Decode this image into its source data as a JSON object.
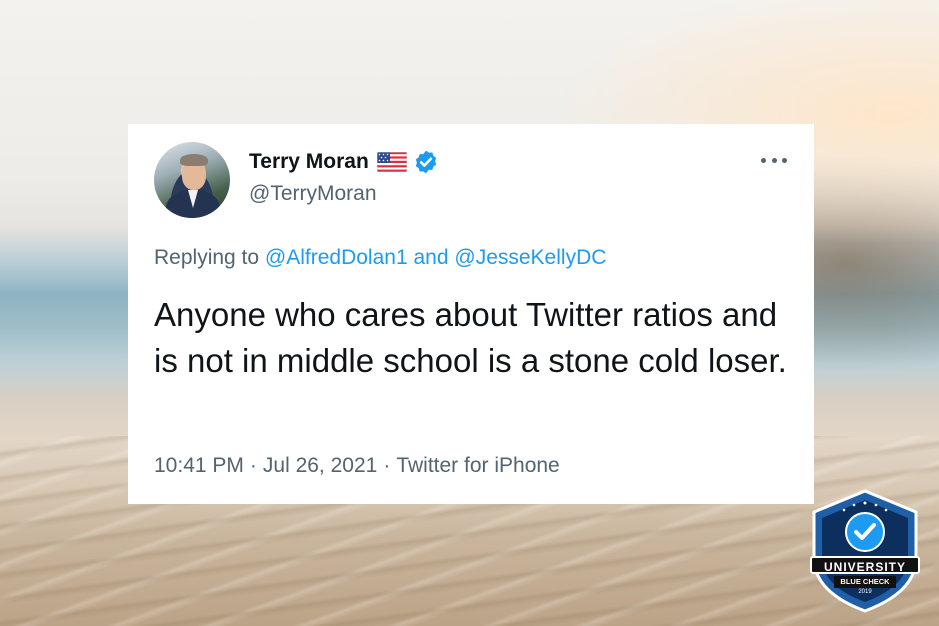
{
  "tweet": {
    "display_name": "Terry Moran",
    "handle": "@TerryMoran",
    "flag_icon": "us-flag-icon",
    "verified_icon": "verified-check-icon",
    "replying_to_prefix": "Replying to",
    "replying_to_user1": "@AlfredDolan1",
    "replying_to_and": "and",
    "replying_to_user2": "@JesseKellyDC",
    "text": "Anyone who cares about Twitter ratios and is not in middle school is a stone cold loser.",
    "time": "10:41 PM",
    "date": "Jul 26, 2021",
    "separator": "·",
    "source": "Twitter for iPhone"
  },
  "badge": {
    "title": "UNIVERSITY",
    "subtitle": "BLUE CHECK",
    "year": "2019"
  },
  "colors": {
    "accent": "#1d9bf0",
    "text_primary": "#0f1419",
    "text_secondary": "#536471",
    "card_background": "#ffffff"
  }
}
